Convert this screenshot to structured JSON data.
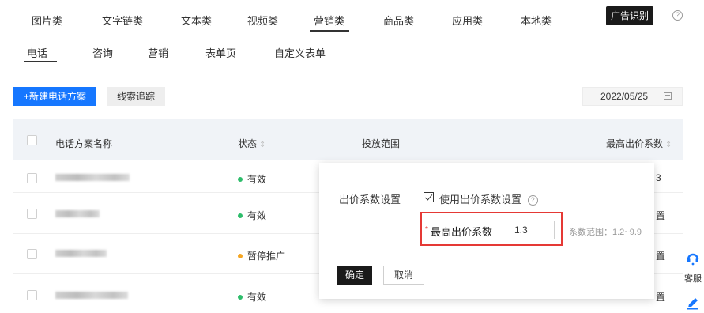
{
  "top_tabs": [
    "图片类",
    "文字链类",
    "文本类",
    "视频类",
    "营销类",
    "商品类",
    "应用类",
    "本地类"
  ],
  "active_top_tab": "营销类",
  "ad_recognition_button": "广告识别",
  "sub_tabs": [
    "电话",
    "咨询",
    "营销",
    "表单页",
    "自定义表单"
  ],
  "active_sub_tab": "电话",
  "toolbar": {
    "new_plan_button": "+新建电话方案",
    "clue_tracking_button": "线索追踪",
    "date_value": "2022/05/25"
  },
  "table": {
    "headers": {
      "name": "电话方案名称",
      "status": "状态",
      "scope": "投放范围",
      "max_coef": "最高出价系数"
    },
    "rows": [
      {
        "status": "有效",
        "status_color": "#2ebd6b",
        "right": "3"
      },
      {
        "status": "有效",
        "status_color": "#2ebd6b",
        "right": "置"
      },
      {
        "status": "暂停推广",
        "status_color": "#f5a623",
        "right": "置"
      },
      {
        "status": "有效",
        "status_color": "#2ebd6b",
        "right": "置"
      }
    ]
  },
  "popover": {
    "label": "出价系数设置",
    "checkbox_label": "使用出价系数设置",
    "checkbox_checked": true,
    "required_mark": "*",
    "coef_label": "最高出价系数",
    "coef_value": "1.3",
    "range_hint": "系数范围：1.2~9.9",
    "ok_button": "确定",
    "cancel_button": "取消"
  },
  "side_float": {
    "service_label": "客服"
  },
  "colors": {
    "primary": "#1677ff",
    "dark": "#1a1a1a",
    "highlight_border": "#e53935"
  }
}
